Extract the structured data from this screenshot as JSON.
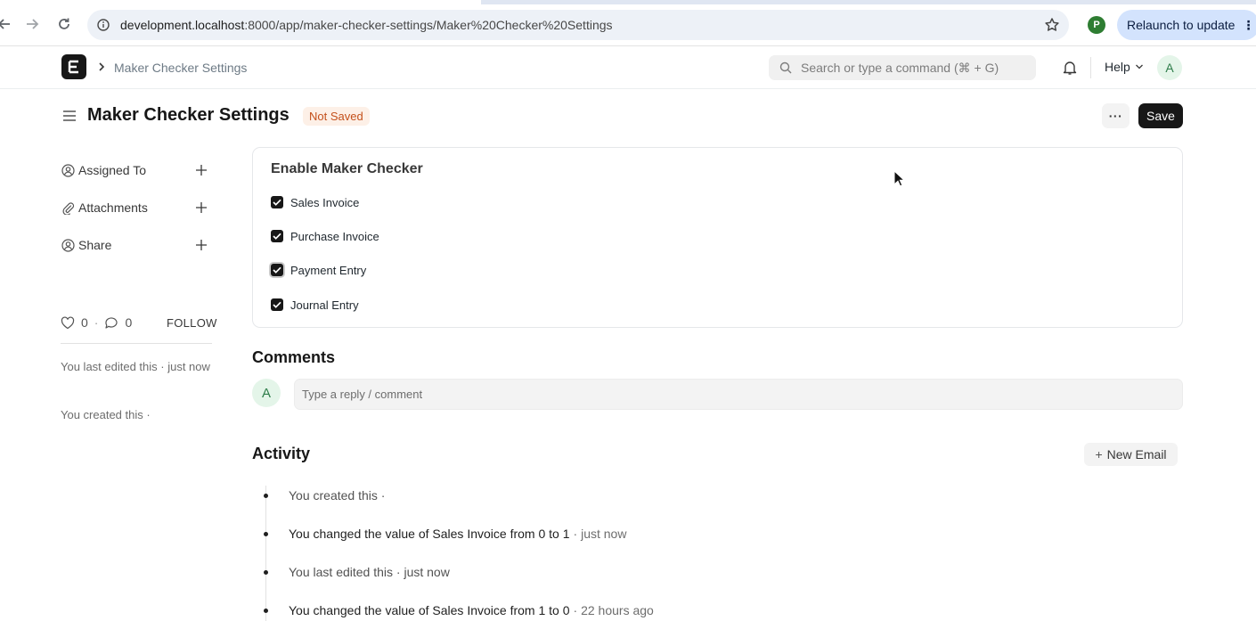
{
  "browser": {
    "url_host": "development.localhost",
    "url_rest": ":8000/app/maker-checker-settings/Maker%20Checker%20Settings",
    "profile_initial": "P",
    "relaunch_label": "Relaunch to update"
  },
  "navbar": {
    "breadcrumb": "Maker Checker Settings",
    "search_placeholder": "Search or type a command (⌘ + G)",
    "help_label": "Help",
    "avatar_initial": "A"
  },
  "page": {
    "title": "Maker Checker Settings",
    "status_badge": "Not Saved",
    "more_label": "···",
    "save_label": "Save"
  },
  "sidebar": {
    "items": [
      {
        "label": "Assigned To",
        "icon": "user-circle-icon"
      },
      {
        "label": "Attachments",
        "icon": "paperclip-icon"
      },
      {
        "label": "Share",
        "icon": "share-user-icon"
      }
    ],
    "likes": "0",
    "comments": "0",
    "follow_label": "FOLLOW",
    "last_edited": "You last edited this · just now",
    "created": "You created this ·"
  },
  "form": {
    "section_title": "Enable Maker Checker",
    "checkboxes": [
      {
        "label": "Sales Invoice",
        "checked": true
      },
      {
        "label": "Purchase Invoice",
        "checked": true
      },
      {
        "label": "Payment Entry",
        "checked": true
      },
      {
        "label": "Journal Entry",
        "checked": true
      }
    ]
  },
  "comments": {
    "heading": "Comments",
    "avatar_initial": "A",
    "placeholder": "Type a reply / comment"
  },
  "activity": {
    "heading": "Activity",
    "new_email_label": "New Email",
    "items": [
      {
        "prefix": "You created this ·",
        "field": "",
        "mid": "",
        "from": "",
        "to_word": "",
        "to": "",
        "time": ""
      },
      {
        "prefix": "You changed the value of",
        "field": "Sales Invoice",
        "mid": "from",
        "from": "0",
        "to_word": "to",
        "to": "1",
        "time": "· just now"
      },
      {
        "prefix": "You last edited this · just now",
        "field": "",
        "mid": "",
        "from": "",
        "to_word": "",
        "to": "",
        "time": ""
      },
      {
        "prefix": "You changed the value of",
        "field": "Sales Invoice",
        "mid": "from",
        "from": "1",
        "to_word": "to",
        "to": "0",
        "time": "· 22 hours ago"
      }
    ]
  },
  "colors": {
    "accent": "#171717",
    "badge_bg": "#fdf0e7",
    "badge_text": "#c4501b",
    "avatar_bg": "#e4f5e9"
  }
}
